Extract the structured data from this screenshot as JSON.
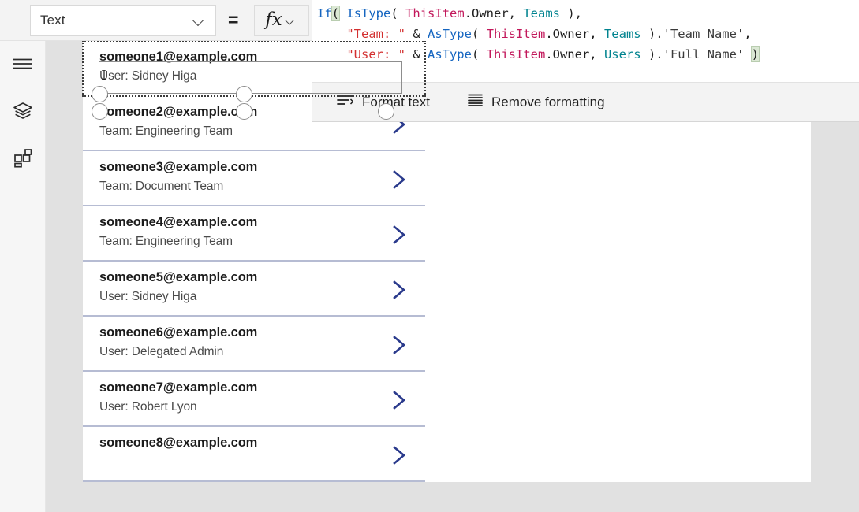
{
  "toolbar": {
    "property_dropdown": {
      "value": "Text",
      "icon": "chevron-down-icon"
    },
    "equals": "=",
    "fx_button": {
      "glyph": "fx",
      "icon": "chevron-down-icon"
    }
  },
  "sidebar": {
    "items": [
      {
        "name": "menu-icon",
        "label": "Menu"
      },
      {
        "name": "tree-view-icon",
        "label": "Tree view"
      },
      {
        "name": "insert-icon",
        "label": "Insert"
      }
    ]
  },
  "formula_bar": {
    "lines": [
      [
        {
          "text": "If",
          "token": "fn"
        },
        {
          "text": "(",
          "token": "paren-hl"
        },
        {
          "text": " ",
          "token": "txt"
        },
        {
          "text": "IsType",
          "token": "fn"
        },
        {
          "text": "( ",
          "token": "txt"
        },
        {
          "text": "ThisItem",
          "token": "this"
        },
        {
          "text": ".Owner, ",
          "token": "txt"
        },
        {
          "text": "Teams",
          "token": "type"
        },
        {
          "text": " ),",
          "token": "txt"
        }
      ],
      [
        {
          "text": "    ",
          "token": "txt"
        },
        {
          "text": "\"Team: \"",
          "token": "str"
        },
        {
          "text": " & ",
          "token": "txt"
        },
        {
          "text": "AsType",
          "token": "fn"
        },
        {
          "text": "( ",
          "token": "txt"
        },
        {
          "text": "ThisItem",
          "token": "this"
        },
        {
          "text": ".Owner, ",
          "token": "txt"
        },
        {
          "text": "Teams",
          "token": "type"
        },
        {
          "text": " ).",
          "token": "txt"
        },
        {
          "text": "'Team Name'",
          "token": "ident"
        },
        {
          "text": ",",
          "token": "txt"
        }
      ],
      [
        {
          "text": "    ",
          "token": "txt"
        },
        {
          "text": "\"User: \"",
          "token": "str"
        },
        {
          "text": " & ",
          "token": "txt"
        },
        {
          "text": "AsType",
          "token": "fn"
        },
        {
          "text": "( ",
          "token": "txt"
        },
        {
          "text": "ThisItem",
          "token": "this"
        },
        {
          "text": ".Owner, ",
          "token": "txt"
        },
        {
          "text": "Users",
          "token": "type"
        },
        {
          "text": " ).",
          "token": "txt"
        },
        {
          "text": "'Full Name'",
          "token": "ident"
        },
        {
          "text": " ",
          "token": "txt"
        },
        {
          "text": ")",
          "token": "paren-hl"
        }
      ]
    ],
    "format_bar": {
      "format_text": {
        "label": "Format text",
        "icon": "format-text-icon"
      },
      "remove_formatting": {
        "label": "Remove formatting",
        "icon": "remove-formatting-icon"
      }
    }
  },
  "gallery": {
    "items": [
      {
        "title": "someone1@example.com",
        "subtitle": "User: Sidney Higa",
        "chevron": "chevron-right-icon"
      },
      {
        "title": "someone2@example.com",
        "subtitle": "Team: Engineering Team",
        "chevron": "chevron-right-icon"
      },
      {
        "title": "someone3@example.com",
        "subtitle": "Team: Document Team",
        "chevron": "chevron-right-icon"
      },
      {
        "title": "someone4@example.com",
        "subtitle": "Team: Engineering Team",
        "chevron": "chevron-right-icon"
      },
      {
        "title": "someone5@example.com",
        "subtitle": "User: Sidney Higa",
        "chevron": "chevron-right-icon"
      },
      {
        "title": "someone6@example.com",
        "subtitle": "User: Delegated Admin",
        "chevron": "chevron-right-icon"
      },
      {
        "title": "someone7@example.com",
        "subtitle": "User: Robert Lyon",
        "chevron": "chevron-right-icon"
      },
      {
        "title": "someone8@example.com",
        "subtitle": "",
        "chevron": "chevron-right-icon"
      }
    ]
  },
  "colors": {
    "chevron": "#2a3a8c",
    "separator": "#b6bcd3",
    "workspace_bg": "#e1e1e1",
    "toolbar_bg": "#f3f3f3",
    "rail_bg": "#f6f6f6",
    "token_function": "#1565c0",
    "token_thisitem": "#c2185b",
    "token_type": "#00838f",
    "token_string": "#d32f2f"
  }
}
